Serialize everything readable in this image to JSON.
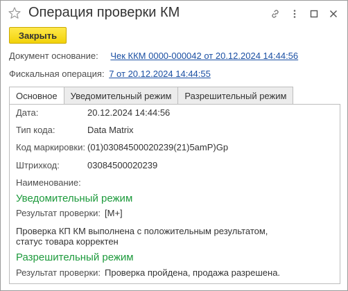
{
  "window": {
    "title": "Операция проверки КМ"
  },
  "toolbar": {
    "close_label": "Закрыть"
  },
  "fields": {
    "base_document_label": "Документ основание:",
    "base_document_value": "Чек ККМ 0000-000042 от 20.12.2024 14:44:56",
    "fiscal_operation_label": "Фискальная операция:",
    "fiscal_operation_value": "7 от 20.12.2024 14:44:55"
  },
  "tabs": [
    {
      "label": "Основное",
      "active": true
    },
    {
      "label": "Уведомительный режим",
      "active": false
    },
    {
      "label": "Разрешительный режим",
      "active": false
    }
  ],
  "main": {
    "date_label": "Дата:",
    "date_value": "20.12.2024 14:44:56",
    "code_type_label": "Тип кода:",
    "code_type_value": "Data Matrix",
    "marking_code_label": "Код маркировки:",
    "marking_code_value": "(01)03084500020239(21)5amP)Gp",
    "barcode_label": "Штрихкод:",
    "barcode_value": "03084500020239",
    "name_label": "Наименование:",
    "notify_section_title": "Уведомительный режим",
    "notify_result_label": "Результат проверки:",
    "notify_result_value": "[M+]",
    "notify_message_line1": "Проверка КП КМ выполнена с положительным результатом,",
    "notify_message_line2": "статус товара корректен",
    "permit_section_title": "Разрешительный режим",
    "permit_result_label": "Результат проверки:",
    "permit_result_value": "Проверка пройдена, продажа разрешена."
  },
  "icons": {
    "favorite": "star-outline-icon",
    "link": "link-icon",
    "more": "more-vertical-icon",
    "maximize": "maximize-icon",
    "close": "close-icon"
  },
  "colors": {
    "accent_button": "#f5d90f",
    "link": "#1a4fa3",
    "section_title": "#1d9a3c"
  }
}
